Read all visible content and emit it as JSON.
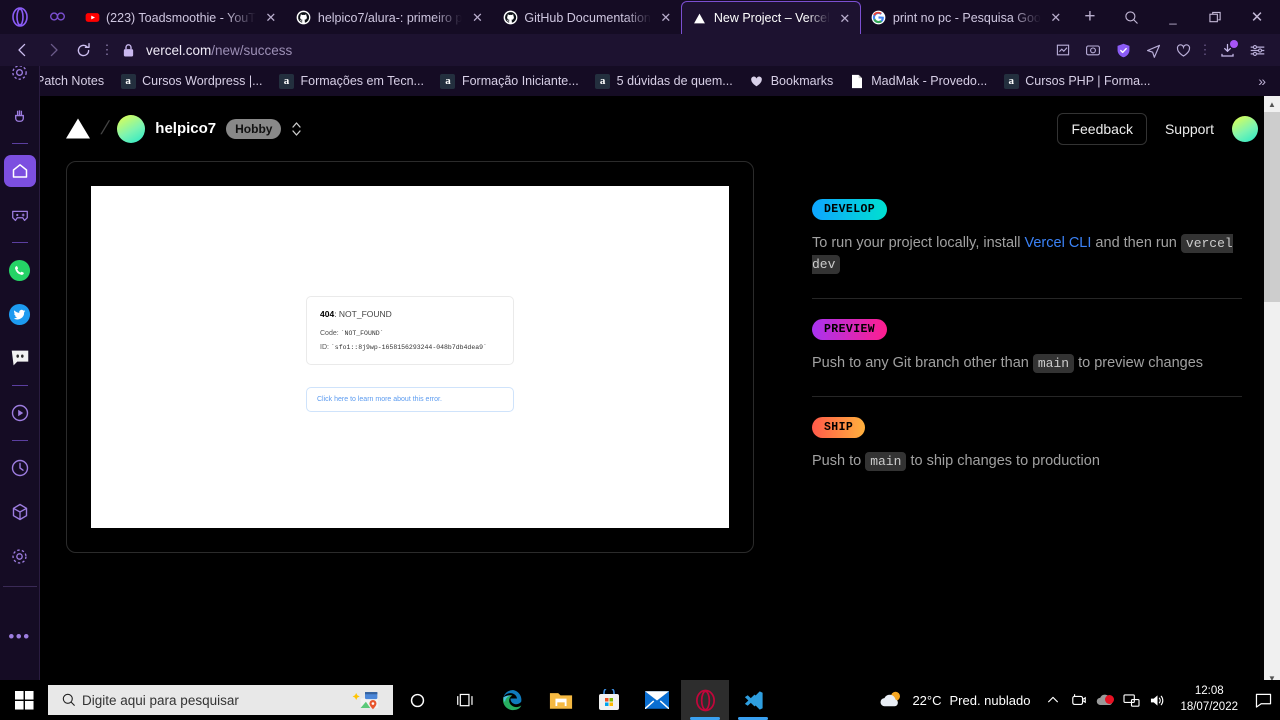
{
  "browser": {
    "tabs": [
      {
        "title": "(223) Toadsmoothie - YouT",
        "favicon": "youtube-icon",
        "active": false
      },
      {
        "title": "helpico7/alura-: primeiro p",
        "favicon": "github-icon",
        "active": false
      },
      {
        "title": "GitHub Documentation",
        "favicon": "github-icon",
        "active": false
      },
      {
        "title": "New Project – Vercel",
        "favicon": "vercel-icon",
        "active": true
      },
      {
        "title": "print no pc - Pesquisa Goo",
        "favicon": "google-icon",
        "active": false
      }
    ],
    "new_tab_label": "+",
    "window_controls": {
      "search": "⌕",
      "minimize": "_",
      "restore": "❐",
      "close": "✕"
    },
    "address": {
      "url_host": "vercel.com",
      "url_path": "/new/success",
      "lock": "lock-icon"
    },
    "nav": {
      "back": "‹",
      "forward": "›",
      "reload": "⟳"
    },
    "bookmarks": [
      {
        "label": "Patch Notes",
        "icon": "overwatch-icon"
      },
      {
        "label": "Cursos Wordpress |...",
        "icon": "amazon-icon"
      },
      {
        "label": "Formações em Tecn...",
        "icon": "amazon-icon"
      },
      {
        "label": "Formação Iniciante...",
        "icon": "amazon-icon"
      },
      {
        "label": "5 dúvidas de quem...",
        "icon": "amazon-icon"
      },
      {
        "label": "Bookmarks",
        "icon": "heart-icon"
      },
      {
        "label": "MadMak - Provedo...",
        "icon": "document-icon"
      },
      {
        "label": "Cursos PHP | Forma...",
        "icon": "amazon-icon"
      }
    ],
    "bookmarks_overflow": "»",
    "sidebar": [
      {
        "name": "settings-gear",
        "icon": "gear-icon",
        "active": false
      },
      {
        "name": "clear-data",
        "icon": "broom-icon",
        "active": false
      },
      {
        "name": "separator-1",
        "icon": "separator",
        "active": false
      },
      {
        "name": "home",
        "icon": "home-icon",
        "active": true
      },
      {
        "name": "gaming",
        "icon": "gamepad-icon",
        "active": false
      },
      {
        "name": "separator-2",
        "icon": "separator",
        "active": false
      },
      {
        "name": "whatsapp",
        "icon": "whatsapp-icon",
        "active": false
      },
      {
        "name": "twitter",
        "icon": "twitter-icon",
        "active": false
      },
      {
        "name": "discord",
        "icon": "discord-icon",
        "active": false
      },
      {
        "name": "separator-3",
        "icon": "separator",
        "active": false
      },
      {
        "name": "player",
        "icon": "play-icon",
        "active": false
      },
      {
        "name": "separator-4",
        "icon": "separator",
        "active": false
      },
      {
        "name": "history",
        "icon": "clock-icon",
        "active": false
      },
      {
        "name": "workspaces",
        "icon": "cube-icon",
        "active": false
      },
      {
        "name": "sidebar-settings",
        "icon": "gear-icon",
        "active": false
      },
      {
        "name": "divider",
        "icon": "divider",
        "active": false
      },
      {
        "name": "more",
        "icon": "ellipsis-icon",
        "active": false
      }
    ]
  },
  "vercel": {
    "header": {
      "logo": "vercel-triangle-icon",
      "separator": "/",
      "username": "helpico7",
      "plan_badge": "Hobby",
      "switcher_icon": "chevron-updown-icon",
      "feedback": "Feedback",
      "support": "Support",
      "avatar": "user-avatar"
    },
    "preview": {
      "error_status": "404",
      "error_name": ": NOT_FOUND",
      "code_label": "Code:",
      "code_value": "`NOT_FOUND`",
      "id_label": "ID:",
      "id_value": "`sfo1::8j9wp-1658156293244-048b7db4dea9`",
      "learn_more": "Click here to learn more about this error."
    },
    "steps": [
      {
        "badge": "DEVELOP",
        "badge_color": "#0ea5ff",
        "text_before": "To run your project locally, install ",
        "link": "Vercel CLI",
        "text_middle": " and then run ",
        "code": "vercel dev",
        "text_after": ""
      },
      {
        "badge": "PREVIEW",
        "badge_color": "#a833f0",
        "text_before": "Push to any Git branch other than ",
        "link": "",
        "text_middle": "",
        "code": "main",
        "text_after": " to preview changes"
      },
      {
        "badge": "SHIP",
        "badge_color": "#ff5a4a",
        "text_before": "Push to ",
        "link": "",
        "text_middle": "",
        "code": "main",
        "text_after": " to ship changes to production"
      }
    ]
  },
  "taskbar": {
    "start": "windows-logo",
    "search_placeholder": "Digite aqui para pesquisar",
    "buttons": [
      {
        "name": "cortana",
        "icon": "circle-icon"
      },
      {
        "name": "task-view",
        "icon": "task-view-icon"
      },
      {
        "name": "microsoft-edge",
        "icon": "edge-icon"
      },
      {
        "name": "file-explorer",
        "icon": "folder-icon"
      },
      {
        "name": "microsoft-store",
        "icon": "store-icon"
      },
      {
        "name": "mail",
        "icon": "mail-icon"
      },
      {
        "name": "opera",
        "icon": "opera-icon"
      },
      {
        "name": "visual-studio-code",
        "icon": "vscode-icon"
      }
    ],
    "tray": {
      "weather_temp": "22°C",
      "weather_desc": "Pred. nublado",
      "chevron": "^",
      "icons": [
        "camera-icon",
        "cloud-sync-off-icon",
        "network-icon",
        "volume-icon"
      ],
      "time": "12:08",
      "date": "18/07/2022",
      "action_center": "notification-icon"
    }
  }
}
